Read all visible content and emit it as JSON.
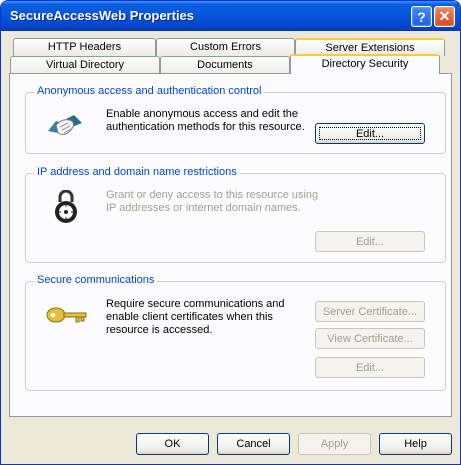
{
  "window": {
    "title": "SecureAccessWeb Properties"
  },
  "titlebar_buttons": {
    "help": "?",
    "close": "✕"
  },
  "tabs": {
    "back_row": [
      "HTTP Headers",
      "Custom Errors",
      "Server Extensions"
    ],
    "front_row": [
      "Virtual Directory",
      "Documents",
      "Directory Security"
    ],
    "active": "Directory Security"
  },
  "sections": {
    "anonymous": {
      "title": "Anonymous access and authentication control",
      "description": "Enable anonymous access and edit the authentication methods for this resource.",
      "edit_label": "Edit...",
      "icon": "handshake-icon"
    },
    "ip": {
      "title": "IP address and domain name restrictions",
      "description": "Grant or deny access to this resource using IP addresses or internet domain names.",
      "edit_label": "Edit...",
      "icon": "combination-lock-icon"
    },
    "secure": {
      "title": "Secure communications",
      "description": "Require secure communications and enable client certificates when this resource is accessed.",
      "server_cert_label": "Server Certificate...",
      "view_cert_label": "View Certificate...",
      "edit_label": "Edit...",
      "icon": "key-icon"
    }
  },
  "footer": {
    "ok": "OK",
    "cancel": "Cancel",
    "apply": "Apply",
    "help": "Help"
  },
  "colors": {
    "titlebar": "#0556dc",
    "dialog_bg": "#ece9d8",
    "group_label": "#0046d5",
    "active_tab_accent": "#ffc83c"
  }
}
